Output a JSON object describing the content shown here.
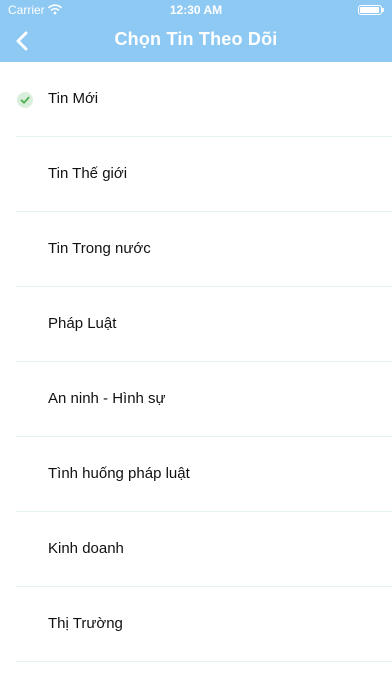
{
  "status": {
    "carrier": "Carrier",
    "time": "12:30 AM"
  },
  "nav": {
    "title": "Chọn Tin Theo Dõi",
    "back_icon": "chevron-left-icon"
  },
  "colors": {
    "header": "#8ec9f4",
    "check": "#4caf50",
    "check_bg": "#d9efdc"
  },
  "items": [
    {
      "label": "Tin Mới",
      "checked": true
    },
    {
      "label": "Tin Thế giới",
      "checked": false
    },
    {
      "label": "Tin Trong nước",
      "checked": false
    },
    {
      "label": "Pháp Luật",
      "checked": false
    },
    {
      "label": "An ninh - Hình sự",
      "checked": false
    },
    {
      "label": "Tình huống pháp luật",
      "checked": false
    },
    {
      "label": "Kinh doanh",
      "checked": false
    },
    {
      "label": "Thị Trường",
      "checked": false
    }
  ]
}
